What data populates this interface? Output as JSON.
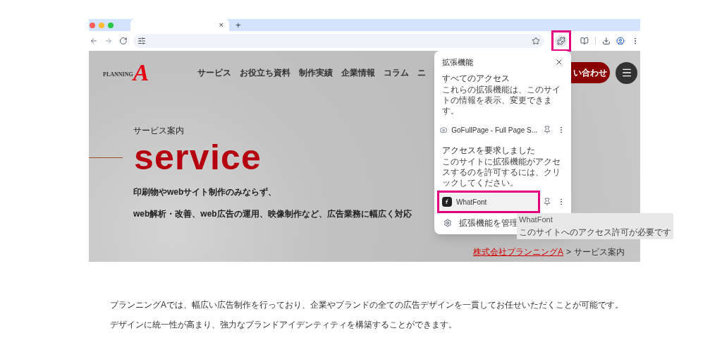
{
  "browser": {
    "tab": {
      "close": "×",
      "selected": true
    },
    "new_tab": "+",
    "extensions_button": {
      "highlighted": true
    }
  },
  "site": {
    "logo": {
      "word": "PLANNING",
      "letter": "A"
    },
    "nav": [
      "サービス",
      "お役立ち資料",
      "制作実績",
      "企業情報",
      "コラム",
      "ニ"
    ],
    "contact_button": "い合わせ",
    "hero": {
      "eyebrow": "サービス案内",
      "title": "service",
      "lines": [
        "印刷物やwebサイト制作のみならず、",
        "web解析・改善、web広告の運用、映像制作など、広告業務に幅広く対応"
      ]
    },
    "breadcrumb": {
      "link": "株式会社プランニングA",
      "separator": ">",
      "current": "サービス案内"
    }
  },
  "extensions_popup": {
    "title": "拡張機能",
    "sections": [
      {
        "heading": "すべてのアクセス",
        "description": "これらの拡張機能は、このサイトの情報を表示、変更できます。",
        "items": [
          {
            "name": "GoFullPage - Full Page S...",
            "kind": "camera",
            "highlighted": false
          }
        ]
      },
      {
        "heading": "アクセスを要求しました",
        "description": "このサイトに拡張機能がアクセスするのを許可するには、クリックしてください。",
        "items": [
          {
            "name": "WhatFont",
            "kind": "font",
            "highlighted": true
          }
        ]
      }
    ],
    "manage": "拡張機能を管理"
  },
  "tooltip": {
    "title": "WhatFont",
    "text": "このサイトへのアクセス許可が必要です"
  },
  "body": [
    "プランニングAでは、幅広い広告制作を行っており、企業やブランドの全ての広告デザインを一貫してお任せいただくことが可能です。",
    "デザインに統一性が高まり、強力なブランドアイデンティティを構築することができます。"
  ]
}
